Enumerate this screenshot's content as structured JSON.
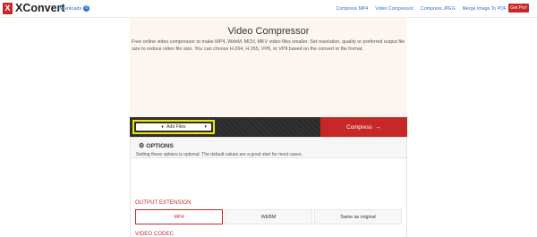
{
  "nav": {
    "logo_mark": "X",
    "logo_text": "XConvert",
    "downloads_label": "Downloads",
    "downloads_count": "0",
    "links": [
      "Compress MP4",
      "Video Compressor",
      "Compress JPEG",
      "Merge Image To PDF"
    ],
    "get_pro": "Get Pro!"
  },
  "hero": {
    "title": "Video Compressor",
    "description": "Free online video compressor to make MP4, WebM, MOV, MKV video files smaller. Set resolution, quality or preferred output file size to reduce video file size. You can choose H.264, H.265, VP8, or VP9 based on the convert to file format."
  },
  "actions": {
    "add_files": "Add Files",
    "compress": "Compress",
    "compress_arrow": "→"
  },
  "options": {
    "title": "OPTIONS",
    "note": "Setting these options is optional. The default values are a good start for most cases.",
    "output_extension_label": "OUTPUT EXTENSION",
    "extensions": [
      "MP4",
      "WEBM",
      "Same as original"
    ],
    "selected_extension": "MP4",
    "video_codec_label": "VIDEO CODEC"
  },
  "colors": {
    "accent": "#c62828",
    "link": "#2e6fd8",
    "highlight": "#f4e600"
  }
}
